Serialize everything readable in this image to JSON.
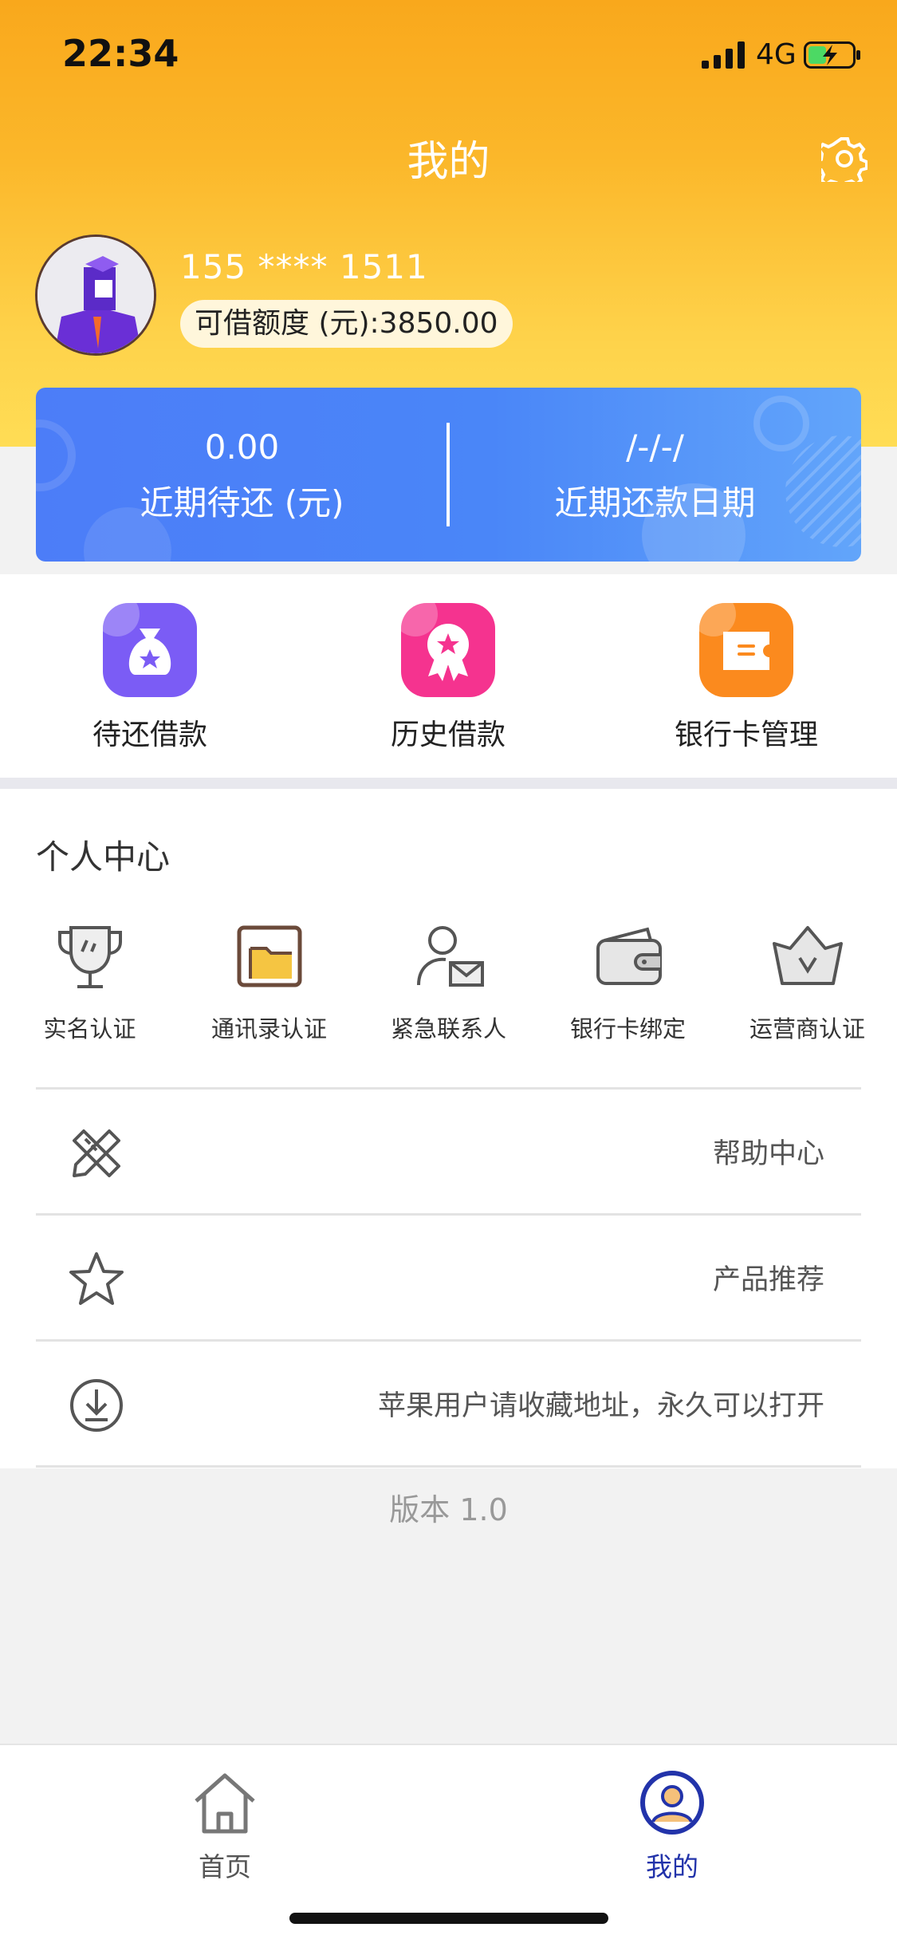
{
  "status_bar": {
    "time": "22:34",
    "network": "4G"
  },
  "header": {
    "title": "我的"
  },
  "user": {
    "phone": "155 **** 1511",
    "credit_label": "可借额度 (元):3850.00"
  },
  "summary_card": {
    "left": {
      "value": "0.00",
      "label": "近期待还 (元)"
    },
    "right": {
      "value": "/-/-/",
      "label": "近期还款日期"
    }
  },
  "quick_actions": [
    {
      "label": "待还借款",
      "icon": "money-bag-icon",
      "color": "#7b5cf5"
    },
    {
      "label": "历史借款",
      "icon": "award-badge-icon",
      "color": "#f5338f"
    },
    {
      "label": "银行卡管理",
      "icon": "card-icon",
      "color": "#fb8a1e"
    }
  ],
  "personal_center": {
    "title": "个人中心",
    "items": [
      {
        "label": "实名认证",
        "icon": "trophy-icon"
      },
      {
        "label": "通讯录认证",
        "icon": "folder-icon"
      },
      {
        "label": "紧急联系人",
        "icon": "contact-icon"
      },
      {
        "label": "银行卡绑定",
        "icon": "wallet-icon"
      },
      {
        "label": "运营商认证",
        "icon": "crown-icon"
      }
    ]
  },
  "rows": [
    {
      "text": "帮助中心",
      "icon": "pencil-ruler-icon"
    },
    {
      "text": "产品推荐",
      "icon": "star-icon"
    },
    {
      "text": "苹果用户请收藏地址，永久可以打开",
      "icon": "download-icon"
    }
  ],
  "version": "版本 1.0",
  "tabbar": {
    "tabs": [
      {
        "label": "首页",
        "icon": "home-icon",
        "active": false
      },
      {
        "label": "我的",
        "icon": "profile-icon",
        "active": true
      }
    ]
  },
  "colors": {
    "accent": "#f9a81c",
    "card_blue": "#4c7df8",
    "tab_active": "#2233aa"
  }
}
